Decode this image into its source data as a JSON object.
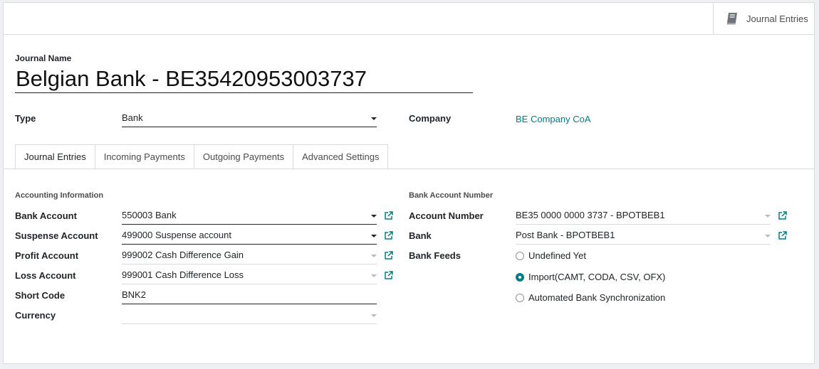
{
  "smart_button": {
    "label": "Journal Entries",
    "icon": "book-icon"
  },
  "journal_name": {
    "label": "Journal Name",
    "value": "Belgian Bank - BE35420953003737"
  },
  "type": {
    "label": "Type",
    "value": "Bank"
  },
  "company": {
    "label": "Company",
    "value": "BE Company CoA"
  },
  "tabs": [
    {
      "label": "Journal Entries",
      "active": true
    },
    {
      "label": "Incoming Payments",
      "active": false
    },
    {
      "label": "Outgoing Payments",
      "active": false
    },
    {
      "label": "Advanced Settings",
      "active": false
    }
  ],
  "accounting": {
    "section_title": "Accounting Information",
    "bank_account": {
      "label": "Bank Account",
      "value": "550003 Bank"
    },
    "suspense_account": {
      "label": "Suspense Account",
      "value": "499000 Suspense account"
    },
    "profit_account": {
      "label": "Profit Account",
      "value": "999002 Cash Difference Gain"
    },
    "loss_account": {
      "label": "Loss Account",
      "value": "999001 Cash Difference Loss"
    },
    "short_code": {
      "label": "Short Code",
      "value": "BNK2"
    },
    "currency": {
      "label": "Currency",
      "value": ""
    }
  },
  "bank": {
    "section_title": "Bank Account Number",
    "account_number": {
      "label": "Account Number",
      "value": "BE35 0000 0000 3737 - BPOTBEB1"
    },
    "bank": {
      "label": "Bank",
      "value": "Post Bank - BPOTBEB1"
    },
    "bank_feeds": {
      "label": "Bank Feeds",
      "options": [
        {
          "label": "Undefined Yet",
          "checked": false
        },
        {
          "label": "Import(CAMT, CODA, CSV, OFX)",
          "checked": true
        },
        {
          "label": "Automated Bank Synchronization",
          "checked": false
        }
      ]
    }
  },
  "colors": {
    "accent": "#017e84",
    "border": "#d8dadd",
    "text": "#212529"
  }
}
